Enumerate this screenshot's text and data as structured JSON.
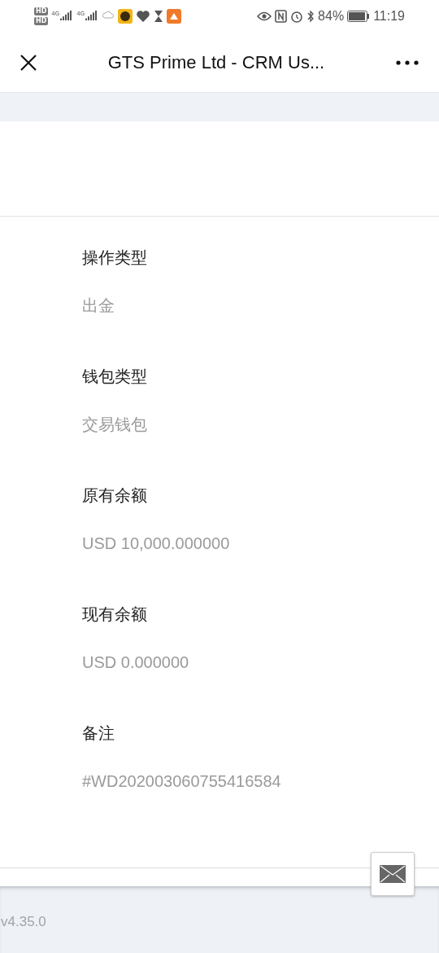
{
  "status_bar": {
    "sim_badges": [
      "HD",
      "HD"
    ],
    "networks": [
      "4G",
      "4G"
    ],
    "battery": "84%",
    "time": "11:19"
  },
  "header": {
    "title": "GTS Prime Ltd - CRM Us..."
  },
  "fields": [
    {
      "label": "操作类型",
      "value": "出金"
    },
    {
      "label": "钱包类型",
      "value": "交易钱包"
    },
    {
      "label": "原有余额",
      "value": "USD 10,000.000000"
    },
    {
      "label": "现有余额",
      "value": "USD 0.000000"
    },
    {
      "label": "备注",
      "value": "#WD202003060755416584"
    }
  ],
  "footer": {
    "version": "v4.35.0"
  }
}
